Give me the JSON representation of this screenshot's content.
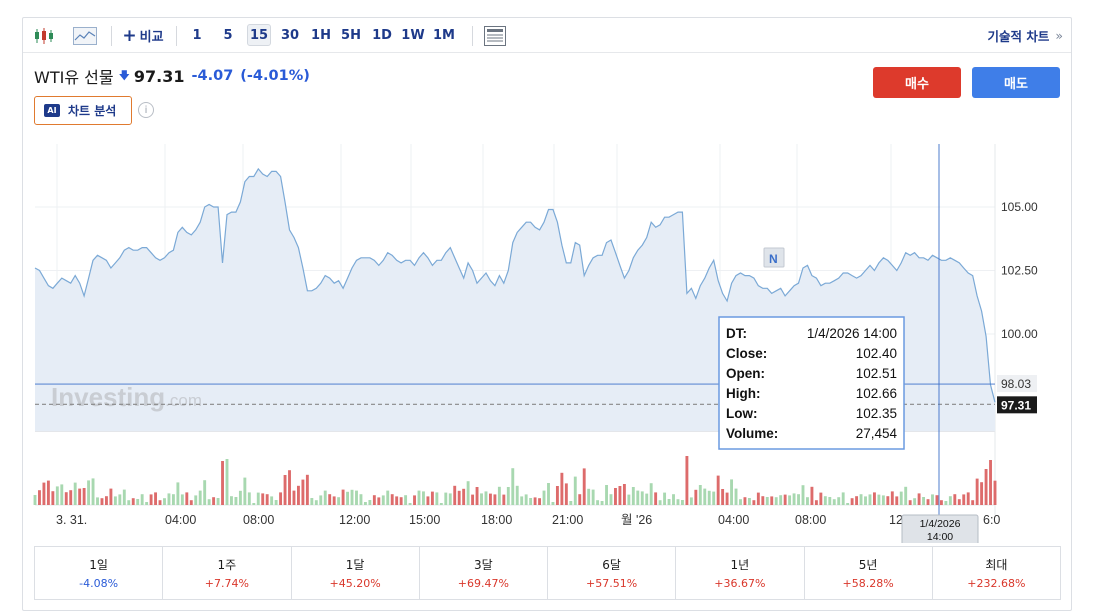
{
  "toolbar": {
    "compare_label": "비교",
    "intervals": [
      "1",
      "5",
      "15",
      "30",
      "1H",
      "5H",
      "1D",
      "1W",
      "1M"
    ],
    "active_interval": "15",
    "tech_chart_label": "기술적 차트",
    "tech_chart_chevron": "»"
  },
  "instrument": {
    "name": "WTI유 선물",
    "price": "97.31",
    "change": "-4.07",
    "change_pct": "(-4.01%)"
  },
  "buttons": {
    "buy": "매수",
    "sell": "매도"
  },
  "ai": {
    "badge": "AI",
    "label": "차트 분석",
    "info": "i"
  },
  "watermark": {
    "brand": "Investing",
    "suffix": ".com"
  },
  "colors": {
    "line": "#7ba9d6",
    "area": "#e6edf6",
    "volume_up": "#a8d8b0",
    "volume_down": "#dd6b6b",
    "negative": "#2a5bd7",
    "positive": "#d9372b"
  },
  "chart_data": {
    "type": "area",
    "y_ticks": [
      "105.00",
      "102.50",
      "100.00"
    ],
    "ylim": [
      98.0,
      108.0
    ],
    "x_tick_labels": [
      "3. 31.",
      "04:00",
      "08:00",
      "12:00",
      "15:00",
      "18:00",
      "21:00",
      "월 '26",
      "04:00",
      "08:00",
      "12:0",
      "6:0"
    ],
    "price_line_value": 98.03,
    "price_line_label": "98.03",
    "last_value": 97.31,
    "last_label": "97.31",
    "marker_label": "N",
    "crosshair_label": [
      "1/4/2026",
      "14:00"
    ],
    "series": [
      {
        "values": [
          102.6,
          102.5,
          102.2,
          101.9,
          101.8,
          102.0,
          102.2,
          102.1,
          102.0,
          102.3,
          102.0,
          101.5,
          102.2,
          102.9,
          103.1,
          103.0,
          102.9,
          102.6,
          102.8,
          103.0,
          103.3,
          103.4,
          103.3,
          103.3,
          103.4,
          103.4,
          103.2,
          103.0,
          102.9,
          103.0,
          103.2,
          103.3,
          104.0,
          104.2,
          104.0,
          103.9,
          104.1,
          104.4,
          105.0,
          105.1,
          105.0,
          105.0,
          102.8,
          104.7,
          104.8,
          104.8,
          105.2,
          106.0,
          106.2,
          106.2,
          106.5,
          106.3,
          106.2,
          106.4,
          106.4,
          106.2,
          105.2,
          104.1,
          103.8,
          103.4,
          102.6,
          101.7,
          101.7,
          101.8,
          102.0,
          102.3,
          102.2,
          102.0,
          102.1,
          101.8,
          102.2,
          102.6,
          102.9,
          103.0,
          103.0,
          103.0,
          102.9,
          102.7,
          102.9,
          103.2,
          103.1,
          102.9,
          102.8,
          102.9,
          102.9,
          102.7,
          103.0,
          103.2,
          103.0,
          102.7,
          102.9,
          102.9,
          103.2,
          103.4,
          103.0,
          102.6,
          102.2,
          102.8,
          102.5,
          102.0,
          102.2,
          102.4,
          102.1,
          101.9,
          102.3,
          102.0,
          102.5,
          103.6,
          104.0,
          104.2,
          104.4,
          104.4,
          104.2,
          104.1,
          104.4,
          104.9,
          104.9,
          104.4,
          103.5,
          102.8,
          102.8,
          103.6,
          103.5,
          102.3,
          102.7,
          103.0,
          103.1,
          103.1,
          103.6,
          103.7,
          103.2,
          102.7,
          102.2,
          102.5,
          103.0,
          103.3,
          103.5,
          103.8,
          104.4,
          104.2,
          104.3,
          104.6,
          104.6,
          104.7,
          104.8,
          104.8,
          101.6,
          101.8,
          101.4,
          101.9,
          102.2,
          102.6,
          102.9,
          102.1,
          101.6,
          101.3,
          102.0,
          102.3,
          102.4,
          102.3,
          102.3,
          102.2,
          101.9,
          101.8,
          101.8,
          101.6,
          101.7,
          101.8,
          101.5,
          101.7,
          101.9,
          102.0,
          102.6,
          102.7,
          102.3,
          102.2,
          101.9,
          102.0,
          102.0,
          102.1,
          102.2,
          102.4,
          102.4,
          102.3,
          102.2,
          102.3,
          102.5,
          102.7,
          102.5,
          102.8,
          103.0,
          102.9,
          102.7,
          102.5,
          102.8,
          103.2,
          103.1,
          103.2,
          103.0,
          103.0,
          102.9,
          103.1,
          103.0,
          102.9,
          102.9,
          103.0,
          102.9,
          102.8,
          102.6,
          102.4,
          102.3,
          101.5,
          100.9,
          99.9,
          98.0,
          97.31
        ]
      }
    ],
    "tooltip": {
      "dt_label": "DT:",
      "dt": "1/4/2026 14:00",
      "close_label": "Close:",
      "close": "102.40",
      "open_label": "Open:",
      "open": "102.51",
      "high_label": "High:",
      "high": "102.66",
      "low_label": "Low:",
      "low": "102.35",
      "volume_label": "Volume:",
      "volume": "27,454"
    }
  },
  "performance": [
    {
      "label": "1일",
      "value": "-4.08%"
    },
    {
      "label": "1주",
      "value": "+7.74%"
    },
    {
      "label": "1달",
      "value": "+45.20%"
    },
    {
      "label": "3달",
      "value": "+69.47%"
    },
    {
      "label": "6달",
      "value": "+57.51%"
    },
    {
      "label": "1년",
      "value": "+36.67%"
    },
    {
      "label": "5년",
      "value": "+58.28%"
    },
    {
      "label": "최대",
      "value": "+232.68%"
    }
  ]
}
